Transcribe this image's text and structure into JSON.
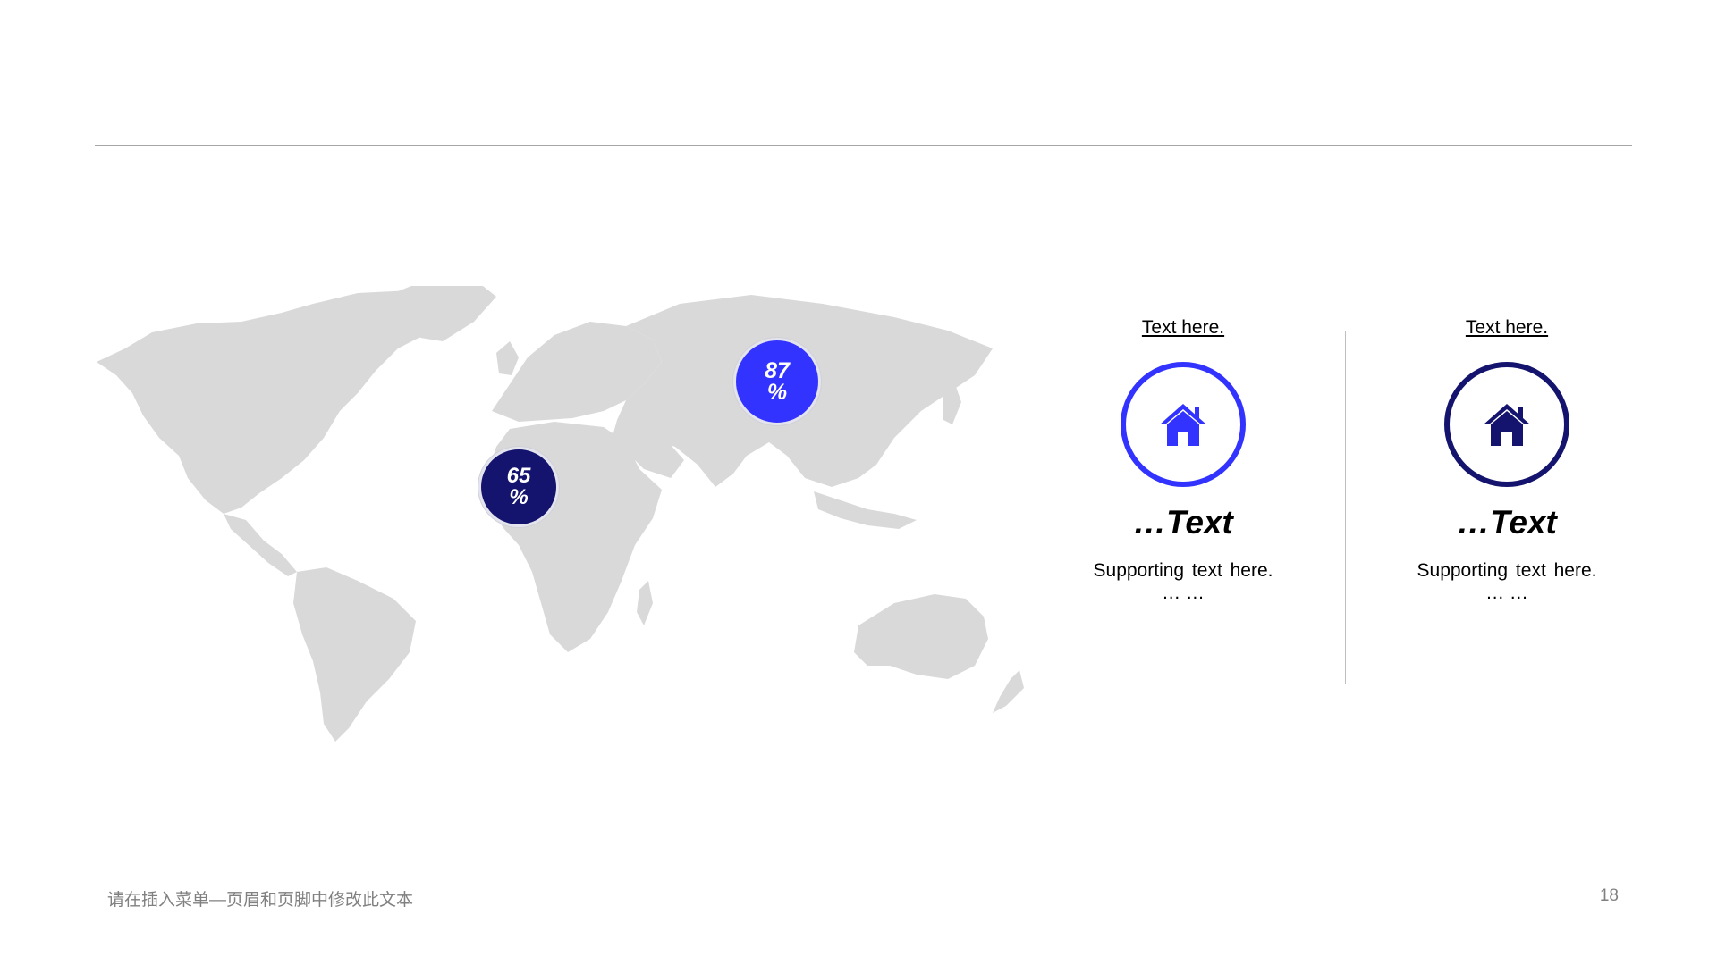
{
  "map": {
    "land_color": "#d9d9d9",
    "badges": [
      {
        "value": "87",
        "unit": "%",
        "color": "#3333ff"
      },
      {
        "value": "65",
        "unit": "%",
        "color": "#14146e"
      }
    ]
  },
  "cards": [
    {
      "link_text": "Text here.",
      "icon": "house-icon",
      "accent": "#3333ff",
      "heading": "…Text",
      "support": "Supporting text here.",
      "ellipsis": "… …"
    },
    {
      "link_text": "Text here.",
      "icon": "house-icon",
      "accent": "#14146e",
      "heading": "…Text",
      "support": "Supporting text here.",
      "ellipsis": "… …"
    }
  ],
  "footer": {
    "text": "请在插入菜单—页眉和页脚中修改此文本",
    "page_number": "18"
  }
}
